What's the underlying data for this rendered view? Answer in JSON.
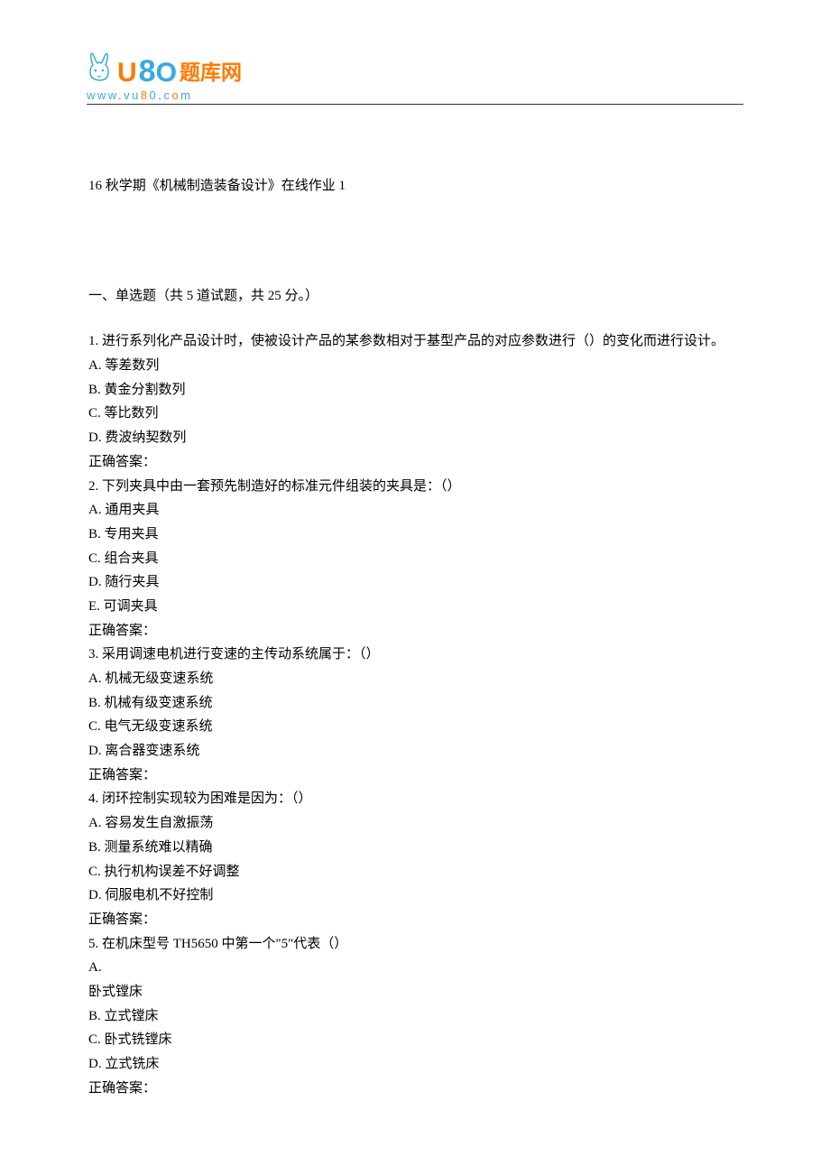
{
  "logo": {
    "chinese": "题库网",
    "url": "www.vu80.com"
  },
  "title": "16 秋学期《机械制造装备设计》在线作业 1",
  "section_heading": "一、单选题（共 5 道试题，共 25 分。）",
  "questions": [
    {
      "stem": "1.   进行系列化产品设计时，使被设计产品的某参数相对于基型产品的对应参数进行（）的变化而进行设计。",
      "options": [
        "A. 等差数列",
        "B. 黄金分割数列",
        "C. 等比数列",
        "D.    费波纳契数列"
      ],
      "answer_label": "正确答案："
    },
    {
      "stem": "2.   下列夹具中由一套预先制造好的标准元件组装的夹具是：（）",
      "options": [
        "A. 通用夹具",
        "B. 专用夹具",
        "C. 组合夹具",
        "D.    随行夹具",
        "E. 可调夹具"
      ],
      "answer_label": "正确答案："
    },
    {
      "stem": "3.   采用调速电机进行变速的主传动系统属于：（）",
      "options": [
        "A. 机械无级变速系统",
        "B.    机械有级变速系统",
        "C. 电气无级变速系统",
        "D.    离合器变速系统"
      ],
      "answer_label": "正确答案："
    },
    {
      "stem": "4.   闭环控制实现较为困难是因为：（）",
      "options": [
        "A. 容易发生自激振荡",
        "B. 测量系统难以精确",
        "C. 执行机构误差不好调整",
        "D. 伺服电机不好控制"
      ],
      "answer_label": "正确答案："
    },
    {
      "stem": "5.   在机床型号 TH5650 中第一个\"5\"代表（）",
      "options": [
        "A.",
        "卧式镗床",
        "B.    立式镗床",
        "C. 卧式铣镗床",
        "D. 立式铣床"
      ],
      "answer_label": "正确答案："
    }
  ]
}
